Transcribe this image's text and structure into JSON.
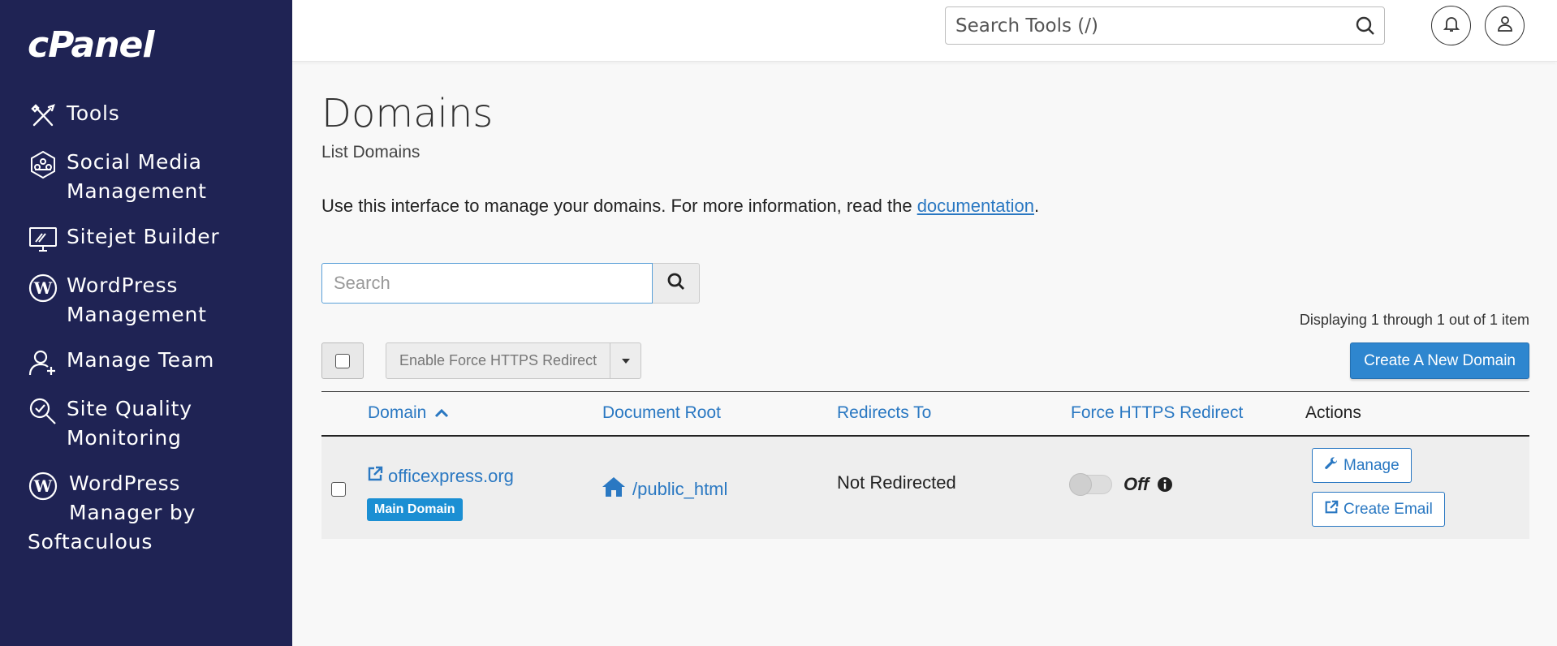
{
  "sidebar": {
    "logo": "cPanel",
    "items": [
      {
        "label": "Tools",
        "icon": "tools-icon"
      },
      {
        "label": "Social Media Management",
        "line1": "Social Media",
        "line2": "Management",
        "icon": "social-media-icon"
      },
      {
        "label": "Sitejet Builder",
        "icon": "sitejet-icon"
      },
      {
        "label": "WordPress Management",
        "line1": "WordPress",
        "line2": "Management",
        "icon": "wordpress-icon"
      },
      {
        "label": "Manage Team",
        "icon": "manage-team-icon"
      },
      {
        "label": "Site Quality Monitoring",
        "line1": "Site Quality",
        "line2": "Monitoring",
        "icon": "site-quality-icon"
      },
      {
        "label": "WordPress Manager by Softaculous",
        "line1": "WordPress",
        "line2": "Manager by",
        "line3": "Softaculous",
        "icon": "wordpress-icon"
      }
    ]
  },
  "header": {
    "search_placeholder": "Search Tools (/)"
  },
  "main": {
    "title": "Domains",
    "subtitle": "List Domains",
    "intro_text": "Use this interface to manage your domains. For more information, read the ",
    "intro_link": "documentation",
    "intro_end": ".",
    "search_placeholder": "Search",
    "displaying": "Displaying 1 through 1 out of 1 item",
    "bulk_action_label": "Enable Force HTTPS Redirect",
    "create_button": "Create A New Domain"
  },
  "table": {
    "columns": [
      "Domain",
      "Document Root",
      "Redirects To",
      "Force HTTPS Redirect",
      "Actions"
    ],
    "rows": [
      {
        "domain": "officexpress.org",
        "badge": "Main Domain",
        "document_root": "/public_html",
        "redirects_to": "Not Redirected",
        "force_https": "Off",
        "actions": [
          "Manage",
          "Create Email"
        ]
      }
    ]
  },
  "colors": {
    "sidebar_bg": "#1f2354",
    "link": "#2a78c2",
    "primary_button": "#2e86cf",
    "badge": "#1b8fd3"
  }
}
